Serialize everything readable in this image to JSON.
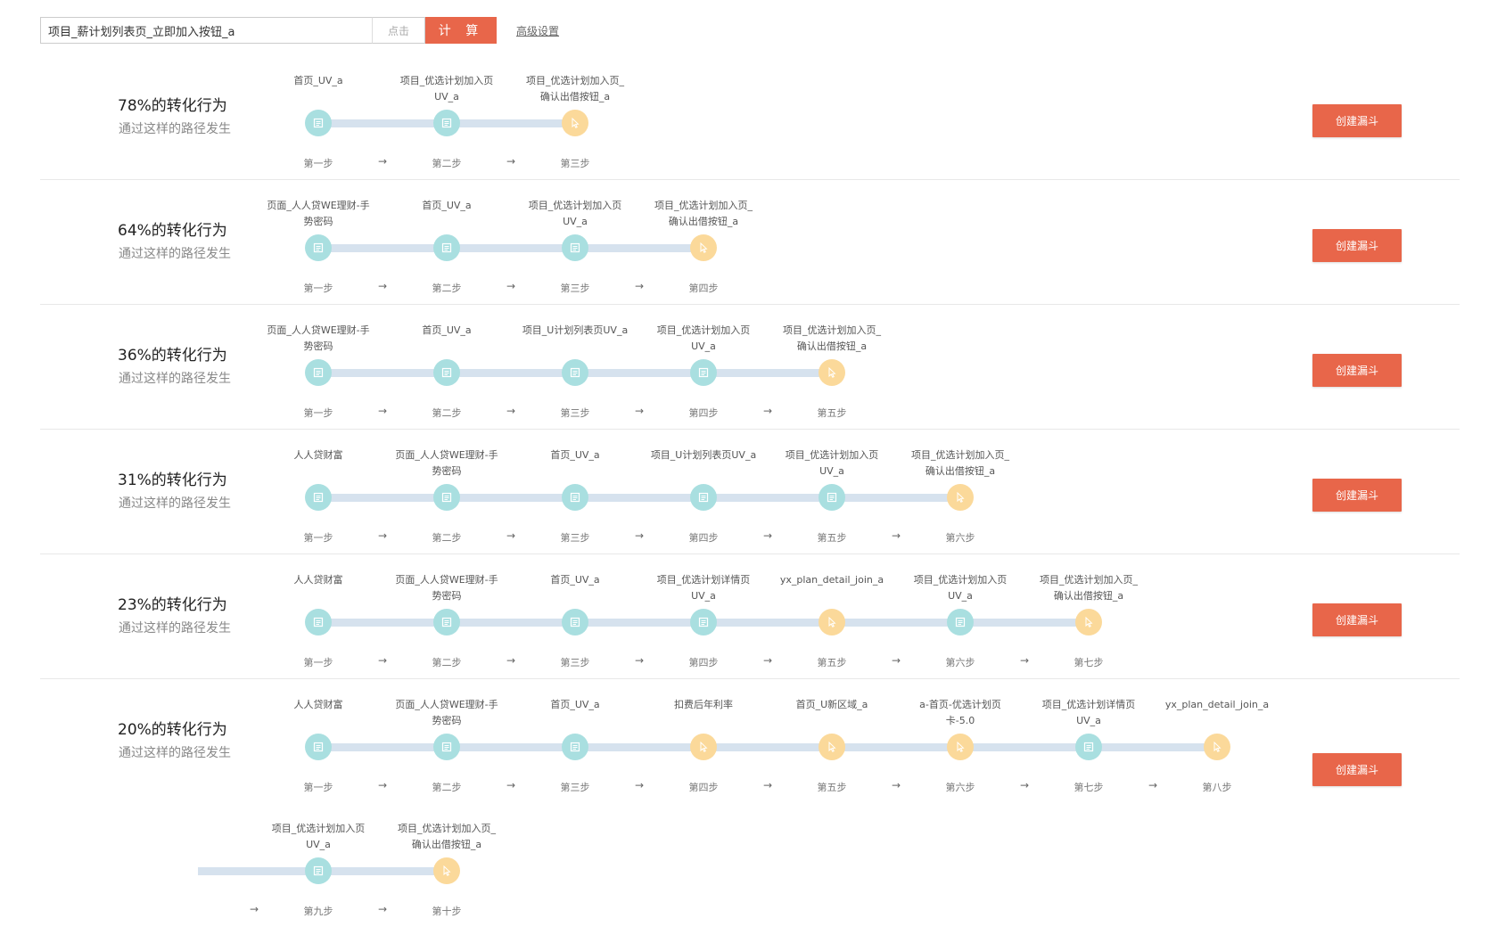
{
  "toolbar": {
    "search_value": "项目_薪计划列表页_立即加入按钮_a",
    "hint": "点击",
    "calc_label": "计 算",
    "advanced_label": "高级设置"
  },
  "common": {
    "subtitle": "通过这样的路径发生",
    "create_label": "创建漏斗",
    "arrow": "→"
  },
  "paths": [
    {
      "title": "78%的转化行为",
      "steps": [
        {
          "name": "首页_UV_a",
          "label": "第一步",
          "type": "page"
        },
        {
          "name": "项目_优选计划加入页\nUV_a",
          "label": "第二步",
          "type": "page"
        },
        {
          "name": "项目_优选计划加入页_\n确认出借按钮_a",
          "label": "第三步",
          "type": "click"
        }
      ]
    },
    {
      "title": "64%的转化行为",
      "steps": [
        {
          "name": "页面_人人贷WE理财-手\n势密码",
          "label": "第一步",
          "type": "page"
        },
        {
          "name": "首页_UV_a",
          "label": "第二步",
          "type": "page"
        },
        {
          "name": "项目_优选计划加入页\nUV_a",
          "label": "第三步",
          "type": "page"
        },
        {
          "name": "项目_优选计划加入页_\n确认出借按钮_a",
          "label": "第四步",
          "type": "click"
        }
      ]
    },
    {
      "title": "36%的转化行为",
      "steps": [
        {
          "name": "页面_人人贷WE理财-手\n势密码",
          "label": "第一步",
          "type": "page"
        },
        {
          "name": "首页_UV_a",
          "label": "第二步",
          "type": "page"
        },
        {
          "name": "项目_U计划列表页UV_a",
          "label": "第三步",
          "type": "page"
        },
        {
          "name": "项目_优选计划加入页\nUV_a",
          "label": "第四步",
          "type": "page"
        },
        {
          "name": "项目_优选计划加入页_\n确认出借按钮_a",
          "label": "第五步",
          "type": "click"
        }
      ]
    },
    {
      "title": "31%的转化行为",
      "steps": [
        {
          "name": "人人贷财富",
          "label": "第一步",
          "type": "page"
        },
        {
          "name": "页面_人人贷WE理财-手\n势密码",
          "label": "第二步",
          "type": "page"
        },
        {
          "name": "首页_UV_a",
          "label": "第三步",
          "type": "page"
        },
        {
          "name": "项目_U计划列表页UV_a",
          "label": "第四步",
          "type": "page"
        },
        {
          "name": "项目_优选计划加入页\nUV_a",
          "label": "第五步",
          "type": "page"
        },
        {
          "name": "项目_优选计划加入页_\n确认出借按钮_a",
          "label": "第六步",
          "type": "click"
        }
      ]
    },
    {
      "title": "23%的转化行为",
      "steps": [
        {
          "name": "人人贷财富",
          "label": "第一步",
          "type": "page"
        },
        {
          "name": "页面_人人贷WE理财-手\n势密码",
          "label": "第二步",
          "type": "page"
        },
        {
          "name": "首页_UV_a",
          "label": "第三步",
          "type": "page"
        },
        {
          "name": "项目_优选计划详情页\nUV_a",
          "label": "第四步",
          "type": "page"
        },
        {
          "name": "yx_plan_detail_join_a",
          "label": "第五步",
          "type": "click"
        },
        {
          "name": "项目_优选计划加入页\nUV_a",
          "label": "第六步",
          "type": "page"
        },
        {
          "name": "项目_优选计划加入页_\n确认出借按钮_a",
          "label": "第七步",
          "type": "click"
        }
      ]
    },
    {
      "title": "20%的转化行为",
      "steps": [
        {
          "name": "人人贷财富",
          "label": "第一步",
          "type": "page"
        },
        {
          "name": "页面_人人贷WE理财-手\n势密码",
          "label": "第二步",
          "type": "page"
        },
        {
          "name": "首页_UV_a",
          "label": "第三步",
          "type": "page"
        },
        {
          "name": "扣费后年利率",
          "label": "第四步",
          "type": "click"
        },
        {
          "name": "首页_U新区域_a",
          "label": "第五步",
          "type": "click"
        },
        {
          "name": "a-首页-优选计划页\n卡-5.0",
          "label": "第六步",
          "type": "click"
        },
        {
          "name": "项目_优选计划详情页\nUV_a",
          "label": "第七步",
          "type": "page"
        },
        {
          "name": "yx_plan_detail_join_a",
          "label": "第八步",
          "type": "click"
        },
        {
          "name": "项目_优选计划加入页\nUV_a",
          "label": "第九步",
          "type": "page"
        },
        {
          "name": "项目_优选计划加入页_\n确认出借按钮_a",
          "label": "第十步",
          "type": "click"
        }
      ]
    }
  ]
}
